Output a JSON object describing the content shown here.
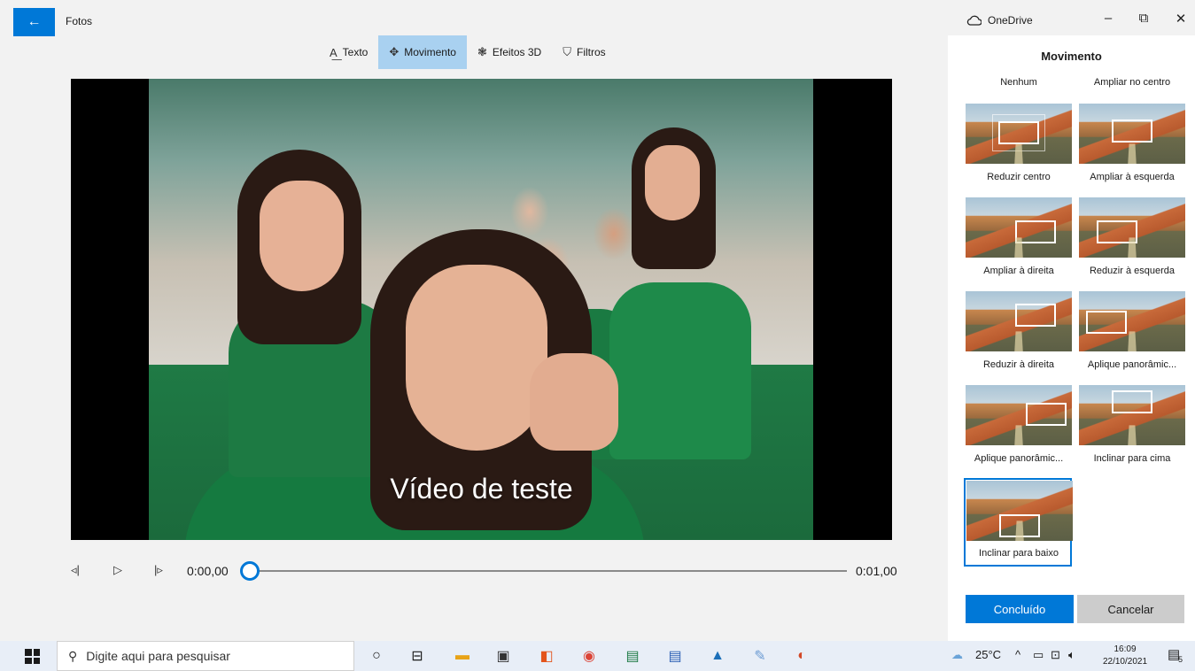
{
  "titlebar": {
    "back_icon": "arrow-left-icon",
    "app_title": "Fotos",
    "onedrive_label": "OneDrive",
    "minimize": "–",
    "restore": "⧉",
    "close": "✕"
  },
  "toolbar": {
    "items": [
      {
        "label": "Texto",
        "icon": "text-icon",
        "active": false
      },
      {
        "label": "Movimento",
        "icon": "motion-icon",
        "active": true
      },
      {
        "label": "Efeitos 3D",
        "icon": "effects-3d-icon",
        "active": false
      },
      {
        "label": "Filtros",
        "icon": "filters-icon",
        "active": false
      }
    ]
  },
  "preview": {
    "caption": "Vídeo de teste"
  },
  "playback": {
    "current_time": "0:00,00",
    "total_time": "0:01,00",
    "progress": 0
  },
  "panel": {
    "title": "Movimento",
    "options": [
      {
        "label": "Nenhum",
        "selected": false
      },
      {
        "label": "Ampliar no centro",
        "selected": false
      },
      {
        "label": "Reduzir centro",
        "selected": false
      },
      {
        "label": "Ampliar à esquerda",
        "selected": false
      },
      {
        "label": "Ampliar à direita",
        "selected": false
      },
      {
        "label": "Reduzir à esquerda",
        "selected": false
      },
      {
        "label": "Reduzir à direita",
        "selected": false
      },
      {
        "label": "Aplique panorâmic...",
        "selected": false
      },
      {
        "label": "Aplique panorâmic...",
        "selected": false
      },
      {
        "label": "Inclinar para cima",
        "selected": false
      },
      {
        "label": "Inclinar para baixo",
        "selected": true
      }
    ],
    "done_label": "Concluído",
    "cancel_label": "Cancelar"
  },
  "taskbar": {
    "search_placeholder": "Digite aqui para pesquisar",
    "weather": "25°C",
    "time": "16:09",
    "date": "22/10/2021",
    "notifications": "5"
  },
  "colors": {
    "accent": "#0078d7",
    "toolbar_active": "#a9d1f0"
  }
}
